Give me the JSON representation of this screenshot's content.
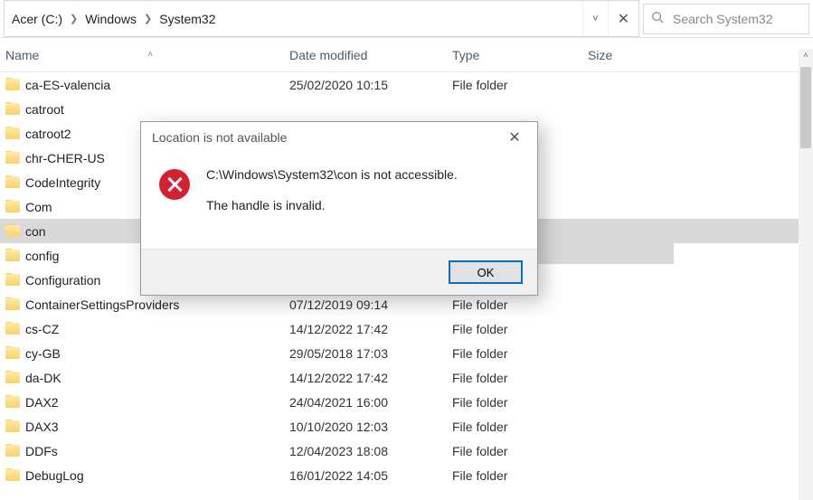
{
  "breadcrumb": {
    "root": "Acer (C:)",
    "mid": "Windows",
    "leaf": "System32"
  },
  "search": {
    "placeholder": "Search System32"
  },
  "columns": {
    "name": "Name",
    "date": "Date modified",
    "type": "Type",
    "size": "Size"
  },
  "rows": [
    {
      "name": "ca-ES-valencia",
      "date": "25/02/2020 10:15",
      "type": "File folder",
      "selected": false
    },
    {
      "name": "catroot",
      "date": "",
      "type": "",
      "selected": false
    },
    {
      "name": "catroot2",
      "date": "",
      "type": "",
      "selected": false
    },
    {
      "name": "chr-CHER-US",
      "date": "",
      "type": "",
      "selected": false
    },
    {
      "name": "CodeIntegrity",
      "date": "",
      "type": "",
      "selected": false
    },
    {
      "name": "Com",
      "date": "",
      "type": "",
      "selected": false
    },
    {
      "name": "con",
      "date": "",
      "type": "",
      "selected": true
    },
    {
      "name": "config",
      "date": "",
      "type": "",
      "selected": false
    },
    {
      "name": "Configuration",
      "date": "",
      "type": "",
      "selected": false
    },
    {
      "name": "ContainerSettingsProviders",
      "date": "07/12/2019 09:14",
      "type": "File folder",
      "selected": false
    },
    {
      "name": "cs-CZ",
      "date": "14/12/2022 17:42",
      "type": "File folder",
      "selected": false
    },
    {
      "name": "cy-GB",
      "date": "29/05/2018 17:03",
      "type": "File folder",
      "selected": false
    },
    {
      "name": "da-DK",
      "date": "14/12/2022 17:42",
      "type": "File folder",
      "selected": false
    },
    {
      "name": "DAX2",
      "date": "24/04/2021 16:00",
      "type": "File folder",
      "selected": false
    },
    {
      "name": "DAX3",
      "date": "10/10/2020 12:03",
      "type": "File folder",
      "selected": false
    },
    {
      "name": "DDFs",
      "date": "12/04/2023 18:08",
      "type": "File folder",
      "selected": false
    },
    {
      "name": "DebugLog",
      "date": "16/01/2022 14:05",
      "type": "File folder",
      "selected": false
    }
  ],
  "dialog": {
    "title": "Location is not available",
    "line1": "C:\\Windows\\System32\\con is not accessible.",
    "line2": "The handle is invalid.",
    "ok": "OK"
  }
}
